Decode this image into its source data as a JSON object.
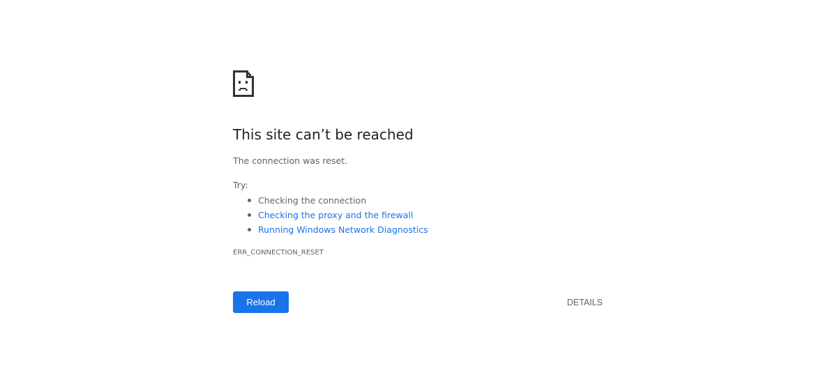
{
  "error": {
    "icon": "sad-page-icon",
    "title": "This site can’t be reached",
    "reason": "The connection was reset.",
    "try_label": "Try:",
    "suggestions": [
      {
        "text": "Checking the connection",
        "is_link": false
      },
      {
        "text": "Checking the proxy and the firewall",
        "is_link": true
      },
      {
        "text": "Running Windows Network Diagnostics",
        "is_link": true
      }
    ],
    "code": "ERR_CONNECTION_RESET"
  },
  "buttons": {
    "reload_label": "Reload",
    "details_label": "DETAILS"
  },
  "colors": {
    "link": "#1a73e8",
    "button": "#1a73e8",
    "text": "#5f6368",
    "heading": "#202124"
  }
}
